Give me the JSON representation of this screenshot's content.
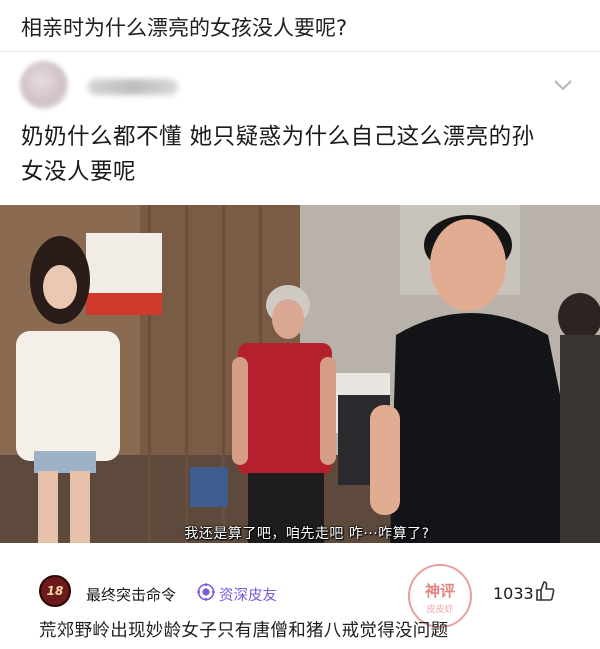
{
  "question": {
    "title": "相亲时为什么漂亮的女孩没人要呢?"
  },
  "answer": {
    "text_line1": "奶奶什么都不懂 她只疑惑为什么自己这么漂亮的孙",
    "text_line2": "女没人要呢",
    "collapse_icon": "chevron-down-icon"
  },
  "video": {
    "subtitle": "我还是算了吧，咱先走吧 咋···咋算了?"
  },
  "comment": {
    "avatar_text": "18",
    "name": "最终突击命令",
    "badge_icon": "purple-badge-icon",
    "badge_label": "资深皮友",
    "stamp_text": "神评",
    "stamp_sub": "皮皮虾",
    "like_count": "1033",
    "like_icon": "thumbs-up-icon",
    "text": "荒郊野岭出现妙龄女子只有唐僧和猪八戒觉得没问题"
  },
  "colors": {
    "badge": "#7a5bd9",
    "stamp": "#d65050"
  }
}
